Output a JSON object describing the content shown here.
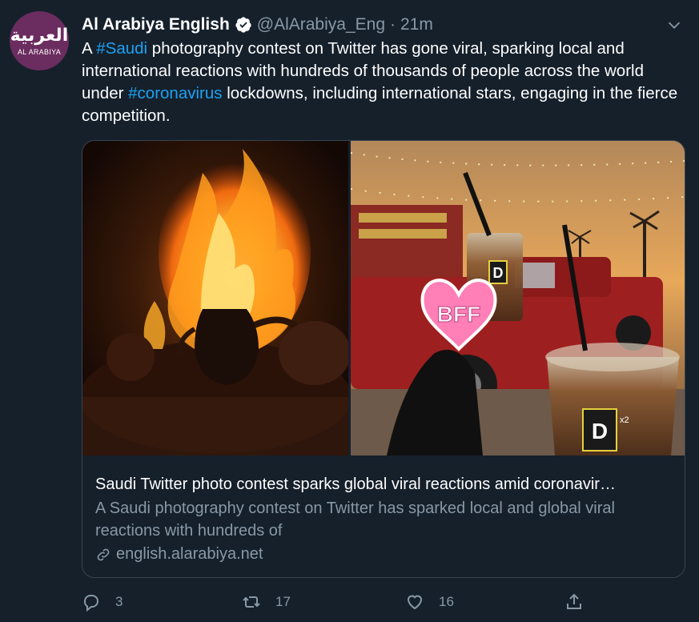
{
  "author": {
    "avatar_text_ar": "العربية",
    "avatar_text_en": "AL ARABIYA",
    "display_name": "Al Arabiya English",
    "handle": "@AlArabiya_Eng",
    "separator": "·",
    "time": "21m"
  },
  "tweet": {
    "text_1": "A ",
    "hashtag_1": "#Saudi",
    "text_2": " photography contest on Twitter has gone viral, sparking local and international reactions with hundreds of thousands of people across the world under ",
    "hashtag_2": "#coronavirus",
    "text_3": " lockdowns, including international stars, engaging in the fierce competition."
  },
  "card": {
    "sticker_text": "BFF",
    "cup_letter": "D",
    "cup_badge": "x2",
    "title": "Saudi Twitter photo contest sparks global viral reactions amid coronavir…",
    "description": "A Saudi photography contest on Twitter has sparked local and global viral reactions with hundreds of",
    "domain": "english.alarabiya.net"
  },
  "actions": {
    "replies": "3",
    "retweets": "17",
    "likes": "16"
  },
  "colors": {
    "background": "#15202b",
    "text": "#ffffff",
    "secondary": "#8899a6",
    "link": "#1da1f2",
    "border": "#38444d",
    "avatar_bg": "#6b2c5f"
  }
}
